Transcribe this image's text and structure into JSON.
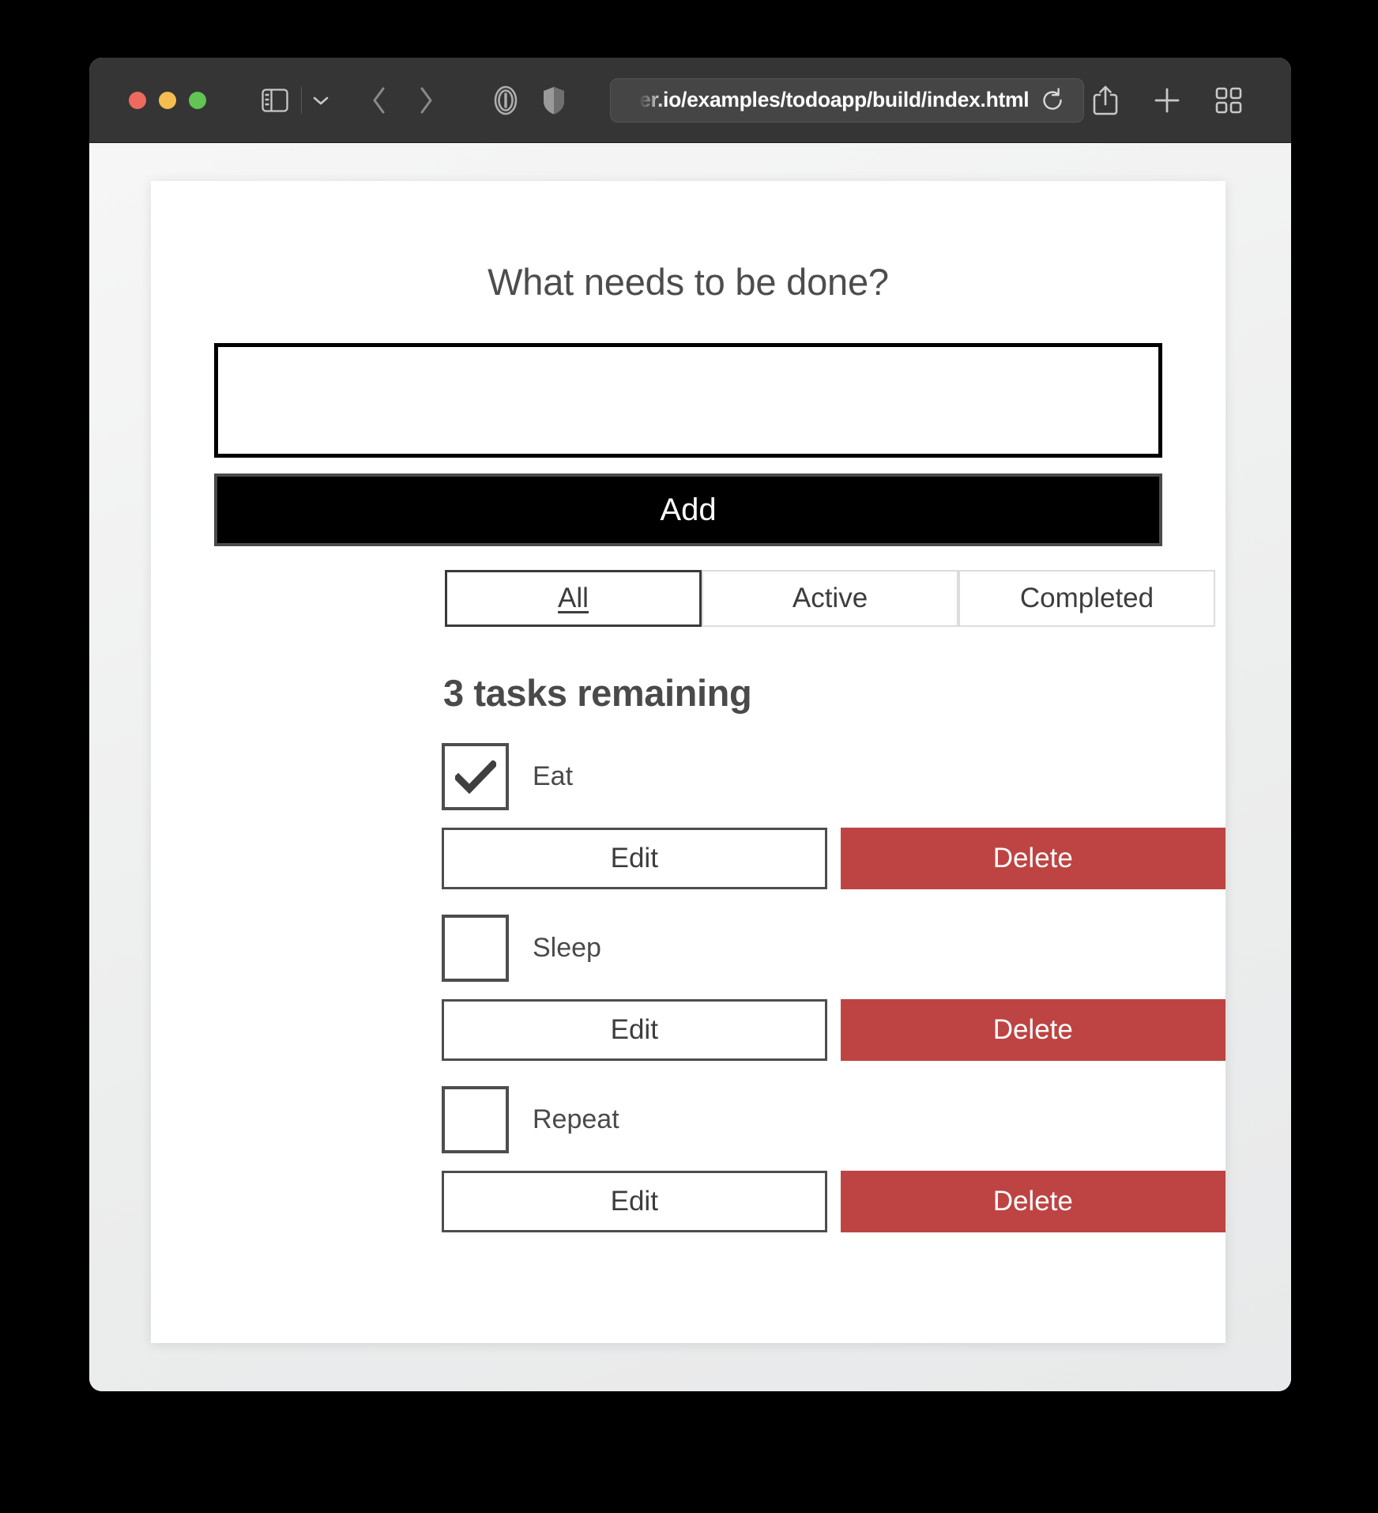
{
  "browser": {
    "traffic_lights": {
      "close_color": "#ed6a5e",
      "minimize_color": "#f5bd4f",
      "maximize_color": "#61c454"
    },
    "url": "er.io/examples/todoapp/build/index.html",
    "url_full_visible": "er.io/examples/todoapp/build/index.html",
    "toolbar_icons": {
      "sidebar": "sidebar-icon",
      "sidebar_chevron": "chevron-down-icon",
      "back": "chevron-left-icon",
      "forward": "chevron-right-icon",
      "reader": "reader-mode-icon",
      "privacy": "shield-icon",
      "reload": "reload-icon",
      "share": "share-icon",
      "new_tab": "plus-icon",
      "tab_overview": "tab-overview-icon"
    }
  },
  "app": {
    "title": "What needs to be done?",
    "input": {
      "value": "",
      "placeholder": ""
    },
    "add_label": "Add",
    "filters": [
      {
        "label": "All",
        "selected": true
      },
      {
        "label": "Active",
        "selected": false
      },
      {
        "label": "Completed",
        "selected": false
      }
    ],
    "list_heading": "3 tasks remaining",
    "remaining_count": 3,
    "todos": [
      {
        "label": "Eat",
        "completed": true,
        "edit_label": "Edit",
        "delete_label": "Delete"
      },
      {
        "label": "Sleep",
        "completed": false,
        "edit_label": "Edit",
        "delete_label": "Delete"
      },
      {
        "label": "Repeat",
        "completed": false,
        "edit_label": "Edit",
        "delete_label": "Delete"
      }
    ],
    "colors": {
      "delete_red": "#bd4442",
      "add_black": "#000000",
      "text_gray": "#4a4a4a"
    }
  }
}
